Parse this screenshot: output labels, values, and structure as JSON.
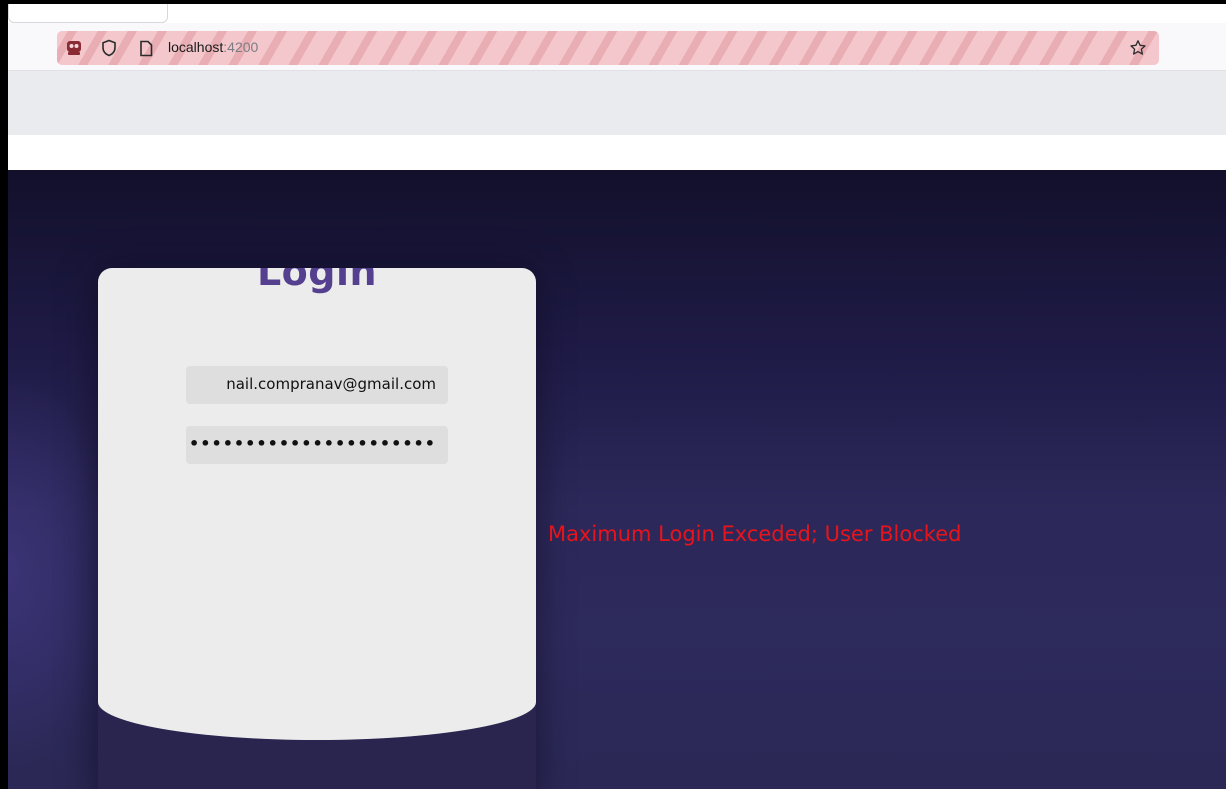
{
  "browser": {
    "url_host": "localhost",
    "url_port": ":4200",
    "icons": {
      "tracking": "privacy-mask-icon",
      "shield": "shield-icon",
      "page": "page-icon",
      "bookmark": "star-icon"
    },
    "urlbar_colors": [
      "#f3c7cb",
      "#e8aeb4"
    ]
  },
  "login": {
    "title": "Login",
    "email_value": "nail.compranav@gmail.com",
    "password_value": "••••••••••••••••••••••••••",
    "title_color": "#55408f"
  },
  "status": {
    "error_message": "Maximum Login Exceded; User Blocked",
    "error_color": "#e8141c"
  }
}
